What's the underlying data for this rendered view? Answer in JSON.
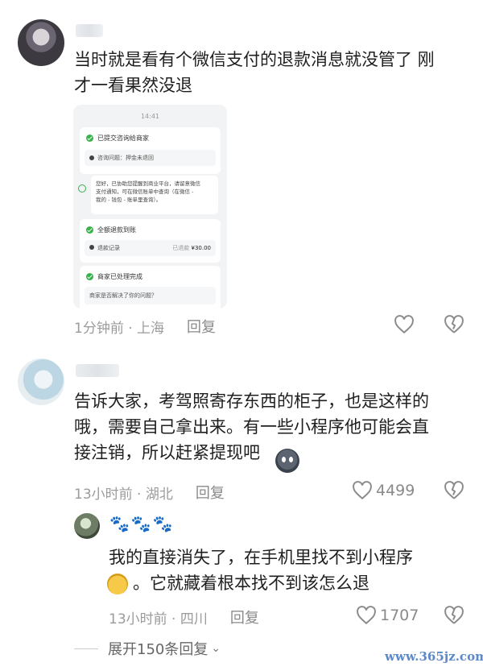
{
  "comments": [
    {
      "text_line1": "当时就是看有个微信支付的退款消息就没管了 刚",
      "text_line2": "才一看果然没退",
      "meta_time_location": "1分钟前 · 上海",
      "reply_label": "回复",
      "like_count": ""
    },
    {
      "text_line1": "告诉大家，考驾照寄存东西的柜子，也是这样的",
      "text_line2": "哦，需要自己拿出来。有一些小程序他可能会直",
      "text_line3": "接注销，所以赶紧提现吧",
      "meta_time_location": "13小时前 · 湖北",
      "reply_label": "回复",
      "like_count": "4499"
    }
  ],
  "reply": {
    "username": "🐾🐾🐾",
    "text_line1": "我的直接消失了，在手机里找不到小程序",
    "text_line2": "。它就藏着根本找不到该怎么退",
    "meta_time_location": "13小时前 · 四川",
    "reply_label": "回复",
    "like_count": "1707"
  },
  "embedded_screenshot": {
    "time": "14:41",
    "card1_title": "已提交咨询给商家",
    "card1_sub": "咨询问题：押金未退回",
    "card2_text_line1": "您好，已协助您提醒到商业平台，请留意微信",
    "card2_text_line2": "支付通知，可在微信账单中查询（在微信 -",
    "card2_text_line3": "我的 - 钱包 - 账单里查询）。",
    "card3_title": "全额退款到账",
    "card3_sub": "退款记录",
    "card3_status": "已退款",
    "card3_amount": "¥30.00",
    "card4_title": "商家已处理完成",
    "card4_sub": "商家是否解决了你的问题？"
  },
  "expand_label": "展开150条回复",
  "watermark": "www.365jz.com",
  "icons": [
    "heart-outline-icon",
    "broken-heart-icon",
    "chevron-down-icon"
  ]
}
